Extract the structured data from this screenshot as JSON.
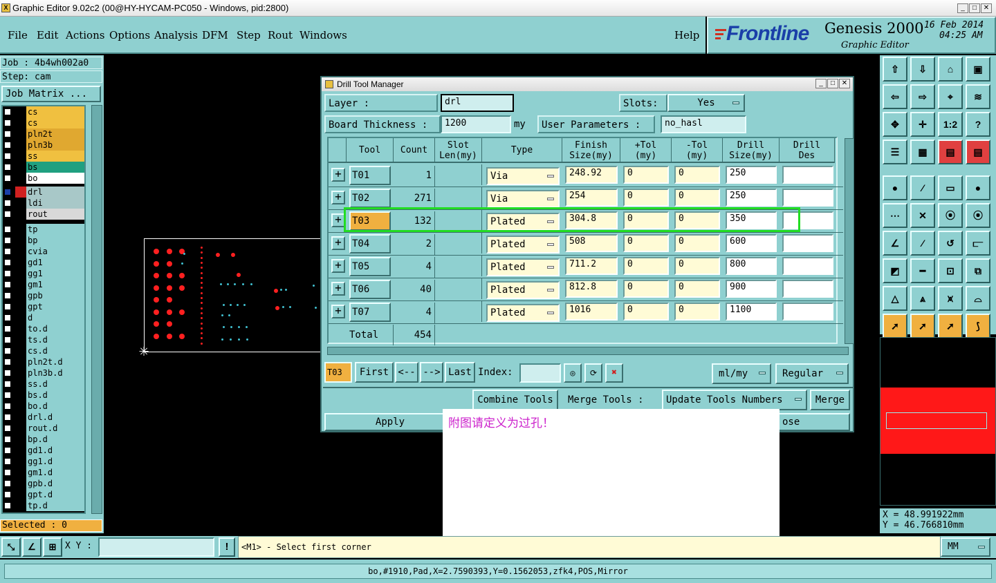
{
  "window": {
    "title": "Graphic Editor 9.02c2 (00@HY-HYCAM-PC050 - Windows, pid:2800)",
    "min_label": "_",
    "max_label": "□",
    "close_label": "✕"
  },
  "menu": {
    "file": "File",
    "edit": "Edit",
    "actions": "Actions",
    "options": "Options",
    "analysis": "Analysis",
    "dfm": "DFM",
    "step": "Step",
    "rout": "Rout",
    "windows": "Windows",
    "help": "Help"
  },
  "brand": {
    "logo": "Frontline",
    "product": "Genesis 2000",
    "subtitle": "Graphic Editor",
    "date": "16 Feb 2014",
    "time": "04:25 AM"
  },
  "left": {
    "job": "Job : 4b4wh002a0",
    "step": "Step: cam",
    "job_matrix": "Job Matrix ...",
    "selected": "Selected : 0",
    "layers": [
      {
        "name": "cs",
        "color": "#f0c040"
      },
      {
        "name": "cs",
        "color": "#f0c040"
      },
      {
        "name": "pln2t",
        "color": "#e0a830"
      },
      {
        "name": "pln3b",
        "color": "#e0a830"
      },
      {
        "name": "ss",
        "color": "#f0c040"
      },
      {
        "name": "bs",
        "color": "#20a080"
      },
      {
        "name": "bo",
        "color": "#ffffff"
      }
    ],
    "drill_layers": [
      {
        "name": "drl",
        "color": "#a8c8c8"
      },
      {
        "name": "ldi",
        "color": "#a8c8c8"
      },
      {
        "name": "rout",
        "color": "#d8d8d8"
      }
    ],
    "misc_layers": [
      "tp",
      "bp",
      "cvia",
      "gd1",
      "gg1",
      "gm1",
      "gpb",
      "gpt",
      "d",
      "to.d",
      "ts.d",
      "cs.d",
      "pln2t.d",
      "pln3b.d",
      "ss.d",
      "bs.d",
      "bo.d",
      "drl.d",
      "rout.d",
      "bp.d",
      "gd1.d",
      "gg1.d",
      "gm1.d",
      "gpb.d",
      "gpt.d",
      "tp.d"
    ]
  },
  "dialog": {
    "title": "Drill Tool Manager",
    "layer_label": "Layer :",
    "layer_value": "drl",
    "slots_label": "Slots:",
    "slots_value": "Yes",
    "board_thickness_label": "Board Thickness :",
    "board_thickness_value": "1200",
    "board_thickness_unit": "my",
    "user_params_label": "User Parameters :",
    "user_params_value": "no_hasl",
    "columns": {
      "tool": "Tool",
      "count": "Count",
      "slot1": "Slot",
      "slot2": "Len(my)",
      "type": "Type",
      "finish1": "Finish",
      "finish2": "Size(my)",
      "ptol1": "+Tol",
      "ptol2": "(my)",
      "ntol1": "-Tol",
      "ntol2": "(my)",
      "drill1": "Drill",
      "drill2": "Size(my)",
      "des1": "Drill",
      "des2": "Des"
    },
    "rows": [
      {
        "tool": "T01",
        "count": "1",
        "type": "Via",
        "finish": "248.92",
        "ptol": "0",
        "ntol": "0",
        "drill": "250",
        "des": ""
      },
      {
        "tool": "T02",
        "count": "271",
        "type": "Via",
        "finish": "254",
        "ptol": "0",
        "ntol": "0",
        "drill": "250",
        "des": ""
      },
      {
        "tool": "T03",
        "count": "132",
        "type": "Plated",
        "finish": "304.8",
        "ptol": "0",
        "ntol": "0",
        "drill": "350",
        "des": ""
      },
      {
        "tool": "T04",
        "count": "2",
        "type": "Plated",
        "finish": "508",
        "ptol": "0",
        "ntol": "0",
        "drill": "600",
        "des": ""
      },
      {
        "tool": "T05",
        "count": "4",
        "type": "Plated",
        "finish": "711.2",
        "ptol": "0",
        "ntol": "0",
        "drill": "800",
        "des": ""
      },
      {
        "tool": "T06",
        "count": "40",
        "type": "Plated",
        "finish": "812.8",
        "ptol": "0",
        "ntol": "0",
        "drill": "900",
        "des": ""
      },
      {
        "tool": "T07",
        "count": "4",
        "type": "Plated",
        "finish": "1016",
        "ptol": "0",
        "ntol": "0",
        "drill": "1100",
        "des": ""
      }
    ],
    "total_label": "Total",
    "total_value": "454",
    "current_tool": "T03",
    "first": "First",
    "prev": "<--",
    "next": "-->",
    "last": "Last",
    "index_label": "Index:",
    "units": "ml/my",
    "mode": "Regular",
    "combine": "Combine Tools",
    "merge_label": "Merge Tools :",
    "update": "Update Tools Numbers",
    "merge": "Merge",
    "apply": "Apply",
    "close": "Close",
    "close_visible": "ose"
  },
  "annotation": {
    "text": "附图请定义为过孔！",
    "color": "#cc22cc"
  },
  "toolbar": {
    "one_to_two": "1:2",
    "help": "?"
  },
  "coords": {
    "x": "X = 48.991922mm",
    "y": "Y = 46.766810mm"
  },
  "bottom": {
    "xy_label": "X Y :",
    "xy_value": "",
    "prompt": "<M1> - Select first corner",
    "units": "MM",
    "status": "bo,#1910,Pad,X=2.7590393,Y=0.1562053,zfk4,POS,Mirror"
  },
  "colors": {
    "panel": "#8fd0d0",
    "highlight": "#22dd22",
    "selected_tool": "#f0b040",
    "pad": "#ff2020",
    "drill_dot": "#40c0d0"
  }
}
